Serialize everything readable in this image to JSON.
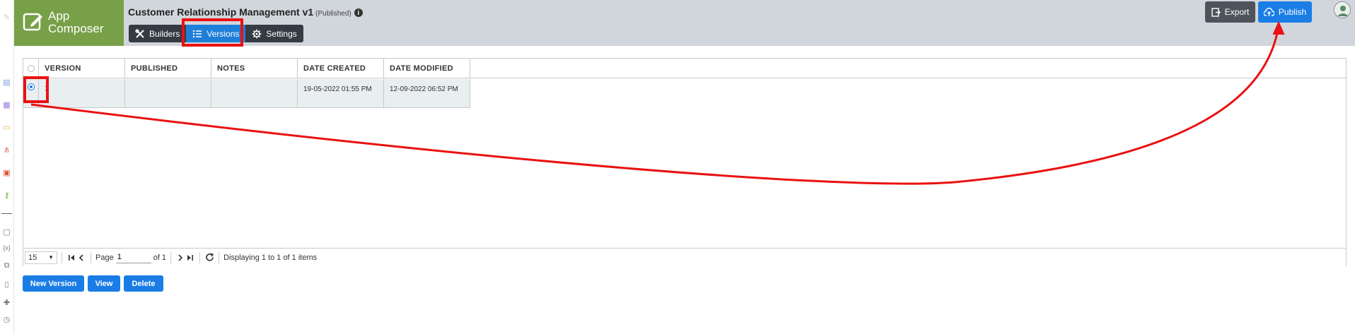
{
  "header": {
    "logo_text_line1": "App",
    "logo_text_line2": "Composer",
    "app_title": "Customer Relationship Management v1",
    "app_status": "(Published)",
    "info_glyph": "i",
    "tabs": [
      {
        "label": "Builders",
        "icon": "tools-icon",
        "active": false
      },
      {
        "label": "Versions",
        "icon": "list-icon",
        "active": true
      },
      {
        "label": "Settings",
        "icon": "gear-icon",
        "active": false
      }
    ],
    "export_label": "Export",
    "publish_label": "Publish"
  },
  "grid": {
    "columns": [
      "VERSION",
      "PUBLISHED",
      "NOTES",
      "DATE CREATED",
      "DATE MODIFIED"
    ],
    "rows": [
      {
        "selected": true,
        "version": "1",
        "published": "",
        "notes": "",
        "date_created": "19-05-2022 01:55 PM",
        "date_modified": "12-09-2022 06:52 PM"
      }
    ],
    "pager": {
      "page_size": "15",
      "page_label": "Page",
      "page_value": "1",
      "of_label": "of 1",
      "display_text": "Displaying 1 to 1 of 1 items"
    }
  },
  "actions": {
    "new_version_label": "New Version",
    "view_label": "View",
    "delete_label": "Delete"
  },
  "colors": {
    "logo_bg": "#77a048",
    "header_bg": "#d1d6dc",
    "tab_bg": "#353b43",
    "active_blue": "#1f7fd8",
    "highlight_red": "#ea1111"
  }
}
